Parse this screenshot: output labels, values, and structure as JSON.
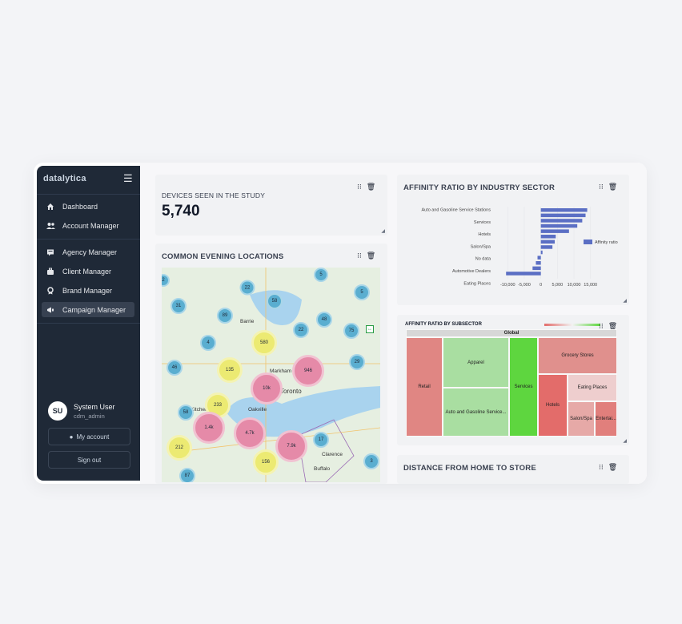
{
  "sidebar": {
    "brand": "datalytica",
    "nav": [
      {
        "label": "Dashboard",
        "icon": "home-icon"
      },
      {
        "label": "Account Manager",
        "icon": "users-icon"
      },
      {
        "label": "Agency Manager",
        "icon": "agency-icon"
      },
      {
        "label": "Client Manager",
        "icon": "briefcase-icon"
      },
      {
        "label": "Brand Manager",
        "icon": "badge-icon"
      },
      {
        "label": "Campaign Manager",
        "icon": "megaphone-icon",
        "active": true
      }
    ],
    "user": {
      "initials": "SU",
      "name": "System User",
      "login": "cdm_admin"
    },
    "my_account": "My account",
    "sign_out": "Sign out"
  },
  "cards": {
    "devices": {
      "title": "DEVICES SEEN IN THE STUDY",
      "value": "5,740"
    },
    "evening": {
      "title": "COMMON EVENING LOCATIONS"
    },
    "affinity": {
      "title": "AFFINITY RATIO BY INDUSTRY SECTOR"
    },
    "subsector": {
      "title": "AFFINITY RATIO BY SUBSECTOR"
    },
    "distance": {
      "title": "DISTANCE FROM HOME TO STORE"
    }
  },
  "map": {
    "place_labels": [
      "Barrie",
      "Markham",
      "Toronto",
      "Oakville",
      "Kitchener",
      "Clarence",
      "Buffalo"
    ],
    "clusters": [
      {
        "label": "2",
        "kind": "blue"
      },
      {
        "label": "22",
        "kind": "blue"
      },
      {
        "label": "5",
        "kind": "blue"
      },
      {
        "label": "31",
        "kind": "blue"
      },
      {
        "label": "58",
        "kind": "blue"
      },
      {
        "label": "5",
        "kind": "blue"
      },
      {
        "label": "89",
        "kind": "blue"
      },
      {
        "label": "22",
        "kind": "blue"
      },
      {
        "label": "48",
        "kind": "blue"
      },
      {
        "label": "75",
        "kind": "blue"
      },
      {
        "label": "4",
        "kind": "blue"
      },
      {
        "label": "580",
        "kind": "yellow"
      },
      {
        "label": "46",
        "kind": "blue"
      },
      {
        "label": "135",
        "kind": "yellow"
      },
      {
        "label": "946",
        "kind": "pink"
      },
      {
        "label": "29",
        "kind": "blue"
      },
      {
        "label": "10k",
        "kind": "pink"
      },
      {
        "label": "233",
        "kind": "yellow"
      },
      {
        "label": "58",
        "kind": "blue"
      },
      {
        "label": "1.4k",
        "kind": "pink"
      },
      {
        "label": "4.7k",
        "kind": "pink"
      },
      {
        "label": "17",
        "kind": "blue"
      },
      {
        "label": "212",
        "kind": "yellow"
      },
      {
        "label": "7.9k",
        "kind": "pink"
      },
      {
        "label": "156",
        "kind": "yellow"
      },
      {
        "label": "3",
        "kind": "blue"
      },
      {
        "label": "87",
        "kind": "blue"
      }
    ]
  },
  "chart_data": [
    {
      "type": "bar",
      "orientation": "horizontal",
      "title": "AFFINITY RATIO BY INDUSTRY SECTOR",
      "category_tick_labels": [
        "Auto and Gasoline Service Stations",
        "Services",
        "Hotels",
        "Salon/Spa",
        "No data",
        "Automotive Dealers",
        "Eating Places"
      ],
      "values": [
        14000,
        13500,
        12500,
        11000,
        8500,
        4500,
        4200,
        3500,
        500,
        -1000,
        -1500,
        -2500,
        -10500
      ],
      "series": [
        {
          "name": "Affinity ratio",
          "color": "#5b6fc4"
        }
      ],
      "xlim": [
        -12000,
        17000
      ],
      "x_ticks": [
        "-10,000",
        "-5,000",
        "0",
        "5,000",
        "10,000",
        "15,000"
      ],
      "legend_position": "right"
    },
    {
      "type": "treemap",
      "title": "AFFINITY RATIO BY SUBSECTOR",
      "root": "Global",
      "cells": [
        {
          "label": "Retail",
          "color": "#e08683"
        },
        {
          "label": "Apparel",
          "color": "#a9dea1"
        },
        {
          "label": "Auto and Gasoline Service...",
          "color": "#a9dea1"
        },
        {
          "label": "Services",
          "color": "#5ed63f"
        },
        {
          "label": "Grocery Stores",
          "color": "#e0908d"
        },
        {
          "label": "Hotels",
          "color": "#e36c6a"
        },
        {
          "label": "Eating Places",
          "color": "#eecece"
        },
        {
          "label": "Salon/Spa",
          "color": "#e6a9a7"
        },
        {
          "label": "Entertai...",
          "color": "#e17f7c"
        }
      ]
    }
  ],
  "colors": {
    "sidebar": "#1f2937",
    "accent_bar": "#5b6fc4"
  }
}
